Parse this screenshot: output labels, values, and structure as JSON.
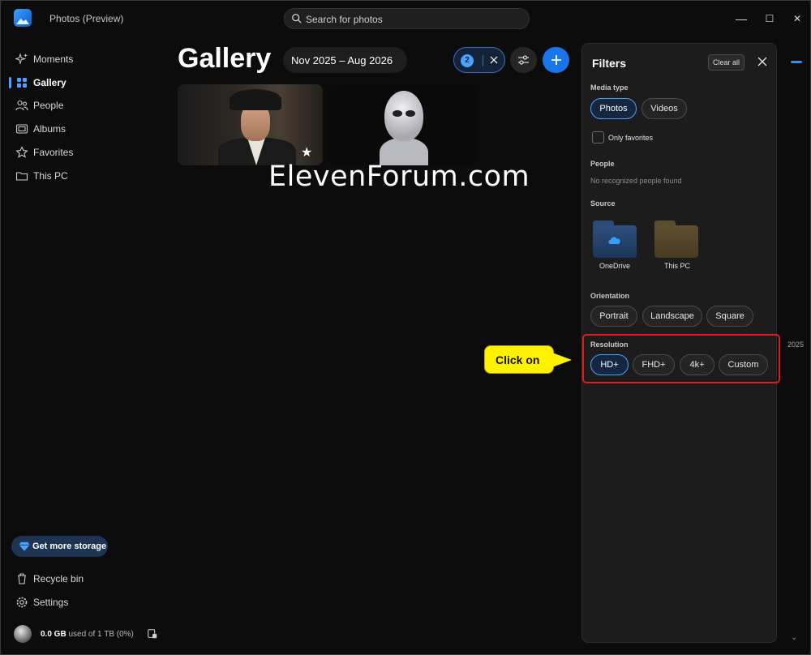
{
  "app": {
    "title": "Photos (Preview)",
    "search_placeholder": "Search for photos"
  },
  "window_controls": {
    "minimize": "—",
    "maximize": "☐",
    "close": "✕"
  },
  "sidebar": {
    "items": [
      {
        "label": "Moments",
        "icon": "sparkle-icon"
      },
      {
        "label": "Gallery",
        "icon": "gallery-icon",
        "active": true
      },
      {
        "label": "People",
        "icon": "people-icon"
      },
      {
        "label": "Albums",
        "icon": "albums-icon"
      },
      {
        "label": "Favorites",
        "icon": "star-icon"
      },
      {
        "label": "This PC",
        "icon": "folder-icon"
      }
    ],
    "storage_button": "Get more storage",
    "bottom_items": [
      {
        "label": "Recycle bin",
        "icon": "trash-icon"
      },
      {
        "label": "Settings",
        "icon": "gear-icon"
      }
    ],
    "usage": {
      "amount": "0.0 GB",
      "detail": "used of 1 TB (0%)"
    }
  },
  "main": {
    "title": "Gallery",
    "date_range": "Nov 2025 – Aug 2026",
    "active_filter_count": "2",
    "thumbnails": [
      {
        "name": "man-in-fedora-photo",
        "favorite": true
      },
      {
        "name": "alien-photo",
        "favorite": false
      }
    ],
    "watermark": "ElevenForum.com"
  },
  "callout": {
    "text": "Click on"
  },
  "filters": {
    "title": "Filters",
    "clear_all": "Clear all",
    "media_type": {
      "label": "Media type",
      "options": [
        "Photos",
        "Videos"
      ],
      "selected": "Photos"
    },
    "only_favorites": "Only favorites",
    "people": {
      "label": "People",
      "note": "No recognized people found"
    },
    "source": {
      "label": "Source",
      "options": [
        "OneDrive",
        "This PC"
      ]
    },
    "orientation": {
      "label": "Orientation",
      "options": [
        "Portrait",
        "Landscape",
        "Square"
      ]
    },
    "resolution": {
      "label": "Resolution",
      "options": [
        "HD+",
        "FHD+",
        "4k+",
        "Custom"
      ],
      "selected": "HD+"
    }
  },
  "timeline": {
    "year": "2025"
  },
  "colors": {
    "accent": "#4aa3ff",
    "highlight": "#e01b1b",
    "callout": "#fff200",
    "add_button": "#1a75e8"
  }
}
